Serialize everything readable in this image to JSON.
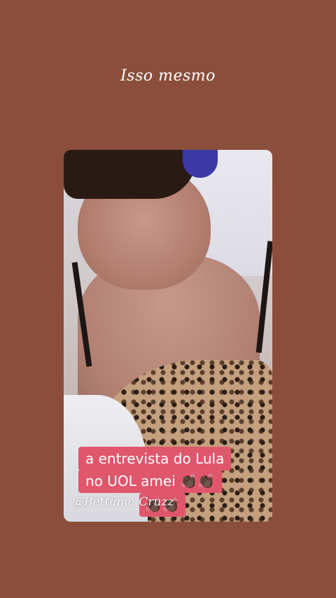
{
  "story": {
    "caption": "Isso mesmo",
    "sticker_lines": [
      "a entrevista do Lula",
      "no UOL amei 👏🏿👏🏿",
      "👏🏿👏🏿"
    ],
    "handle": "@Bettânia Cruzz"
  },
  "colors": {
    "background": "#8b4e3c",
    "sticker": "#e0566b",
    "text": "#ffffff"
  }
}
